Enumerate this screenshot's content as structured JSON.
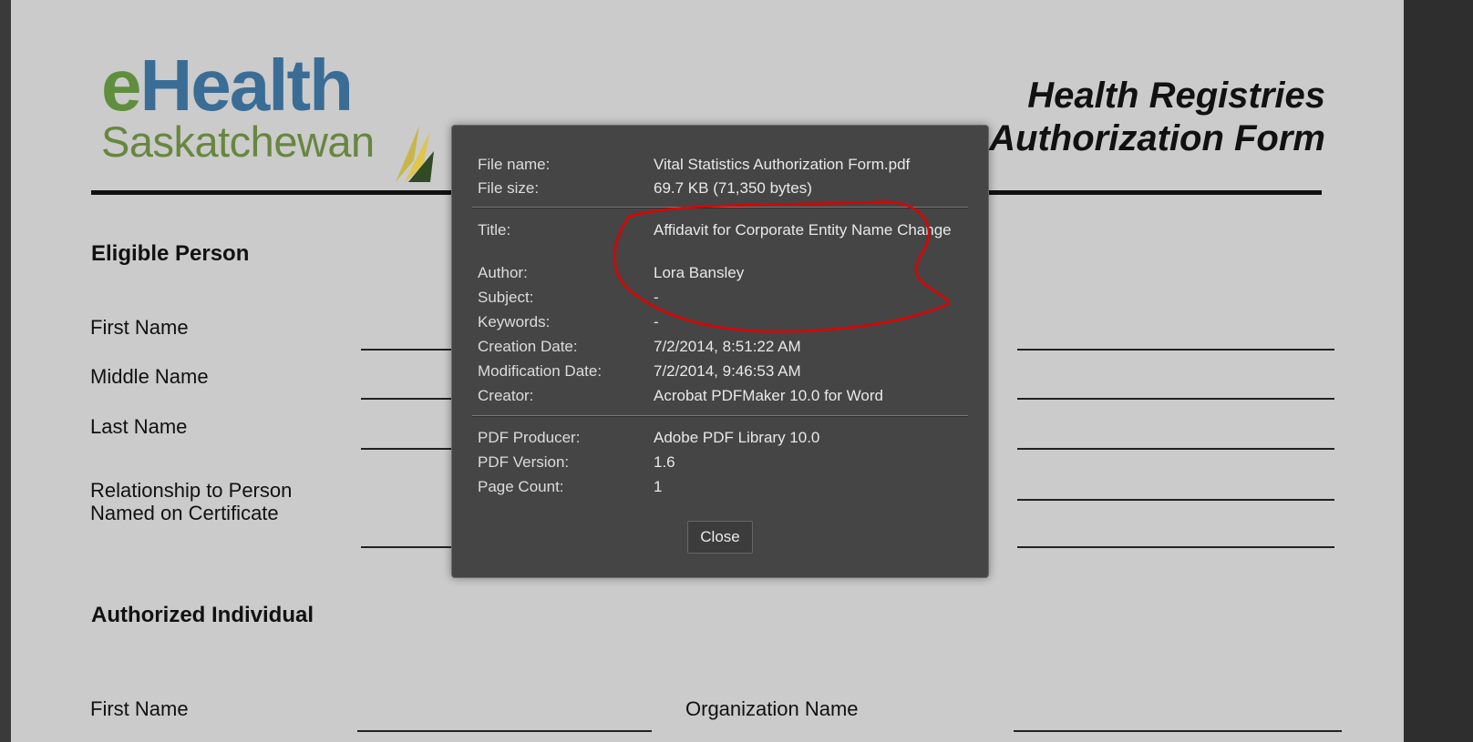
{
  "document": {
    "logo": {
      "e": "e",
      "health": "Health",
      "region": "Saskatchewan"
    },
    "title_line1": "Health Registries",
    "title_line2": "Authorization Form",
    "sections": {
      "eligible": "Eligible Person",
      "authorized": "Authorized Individual"
    },
    "fields": {
      "first_name": "First Name",
      "middle_name": "Middle Name",
      "last_name": "Last Name",
      "relationship_line1": "Relationship to Person",
      "relationship_line2": "Named on Certificate",
      "auth_first_name": "First Name",
      "organization_name": "Organization Name"
    }
  },
  "dialog": {
    "file_name": {
      "label": "File name:",
      "value": "Vital Statistics Authorization Form.pdf"
    },
    "file_size": {
      "label": "File size:",
      "value": "69.7 KB (71,350 bytes)"
    },
    "title": {
      "label": "Title:",
      "value": "Affidavit for Corporate Entity Name Change"
    },
    "author": {
      "label": "Author:",
      "value": "Lora Bansley"
    },
    "subject": {
      "label": "Subject:",
      "value": "-"
    },
    "keywords": {
      "label": "Keywords:",
      "value": "-"
    },
    "creation_date": {
      "label": "Creation Date:",
      "value": "7/2/2014, 8:51:22 AM"
    },
    "modification_date": {
      "label": "Modification Date:",
      "value": "7/2/2014, 9:46:53 AM"
    },
    "creator": {
      "label": "Creator:",
      "value": "Acrobat PDFMaker 10.0 for Word"
    },
    "pdf_producer": {
      "label": "PDF Producer:",
      "value": "Adobe PDF Library 10.0"
    },
    "pdf_version": {
      "label": "PDF Version:",
      "value": "1.6"
    },
    "page_count": {
      "label": "Page Count:",
      "value": "1"
    },
    "close_label": "Close"
  },
  "colors": {
    "page_bg": "#cbcbcb",
    "dialog_bg": "#454545",
    "annotation": "#e00000",
    "logo_green": "#5f8e3d",
    "logo_blue": "#3a6d95"
  }
}
